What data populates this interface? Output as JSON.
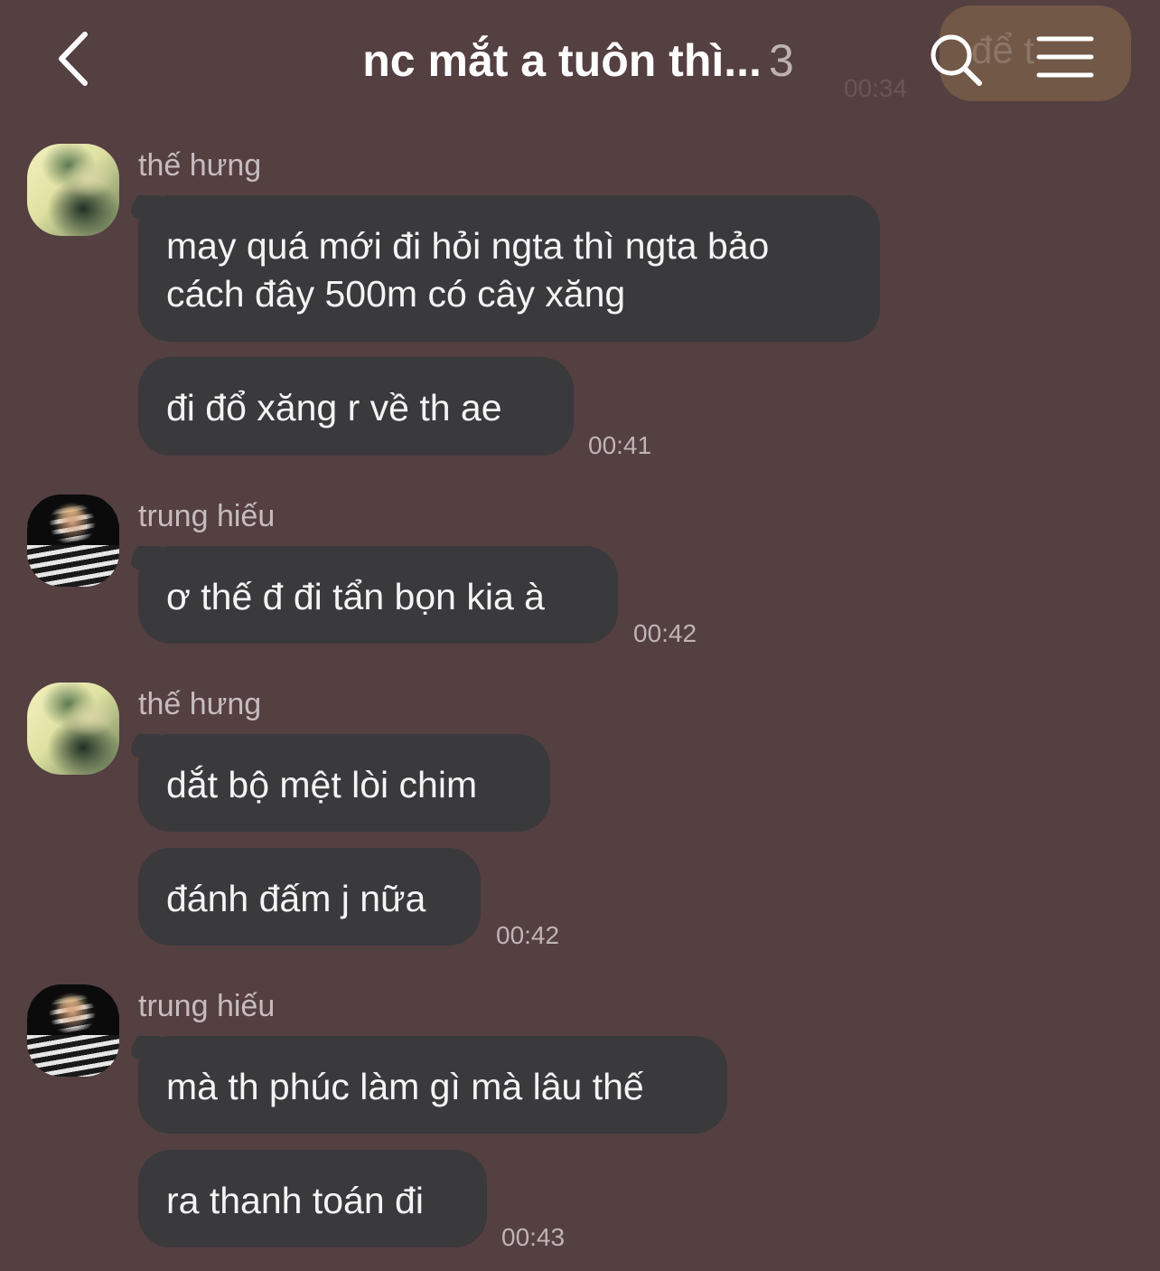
{
  "header": {
    "title": "nc mắt a tuôn thì...",
    "member_count": "3",
    "back_icon": "chevron-left-icon",
    "search_icon": "search-icon",
    "menu_icon": "hamburger-menu-icon",
    "ghost_text": "để t",
    "ghost_time": "00:34"
  },
  "messages": [
    {
      "sender": "thế hưng",
      "avatar": "avatar-the-hung",
      "bubbles": [
        "may quá mới đi hỏi ngta thì ngta bảo\ncách đây 500m có cây xăng",
        "đi đổ xăng r về th ae"
      ],
      "time": "00:41"
    },
    {
      "sender": "trung hiếu",
      "avatar": "avatar-trung-hieu",
      "bubbles": [
        "ơ thế đ đi tẩn bọn kia à"
      ],
      "time": "00:42"
    },
    {
      "sender": "thế hưng",
      "avatar": "avatar-the-hung",
      "bubbles": [
        "dắt bộ mệt lòi chim",
        "đánh đấm j nữa"
      ],
      "time": "00:42"
    },
    {
      "sender": "trung hiếu",
      "avatar": "avatar-trung-hieu",
      "bubbles": [
        "mà th phúc làm gì mà lâu thế",
        "ra thanh toán đi"
      ],
      "time": "00:43"
    }
  ]
}
